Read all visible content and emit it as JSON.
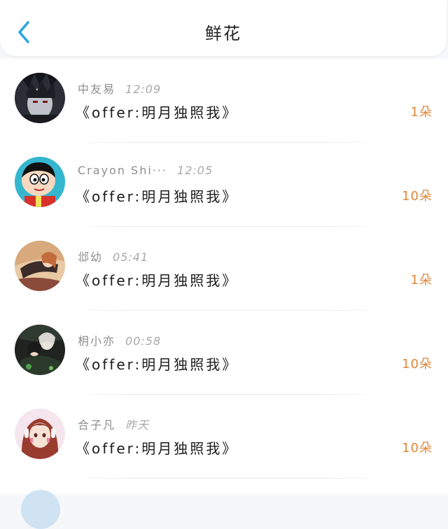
{
  "header": {
    "title": "鲜花",
    "back_icon": "chevron-left-icon",
    "accent_color": "#2aa3e8"
  },
  "colors": {
    "count": "#e0873a",
    "meta": "#8e8e8e"
  },
  "items": [
    {
      "name": "中友易",
      "time": "12:09",
      "message": "《offer:明月独照我》",
      "count": "1朵",
      "avatar": "dark-hair-anime-avatar"
    },
    {
      "name": "Crayon Shi···",
      "time": "12:05",
      "message": "《offer:明月独照我》",
      "count": "10朵",
      "avatar": "crayon-shin-chan-avatar"
    },
    {
      "name": "邶幼",
      "time": "05:41",
      "message": "《offer:明月独照我》",
      "count": "1朵",
      "avatar": "reclining-girl-avatar"
    },
    {
      "name": "枂小亦",
      "time": "00:58",
      "message": "《offer:明月独照我》",
      "count": "10朵",
      "avatar": "couple-illustration-avatar"
    },
    {
      "name": "合子凡",
      "time": "昨天",
      "message": "《offer:明月独照我》",
      "count": "10朵",
      "avatar": "pink-hair-girl-avatar"
    }
  ]
}
